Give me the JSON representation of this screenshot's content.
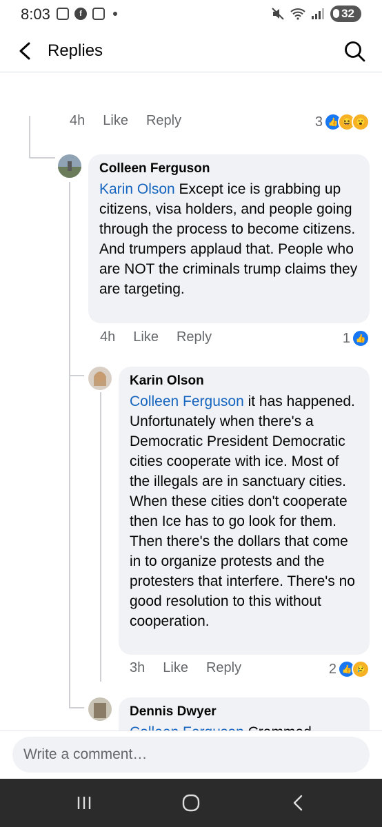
{
  "status_bar": {
    "time": "8:03",
    "battery": "32"
  },
  "header": {
    "title": "Replies"
  },
  "top_meta": {
    "time": "4h",
    "like": "Like",
    "reply": "Reply",
    "reaction_count": "3"
  },
  "comments": [
    {
      "author": "Colleen Ferguson",
      "mention": "Karin Olson",
      "text": " Except ice is grabbing up citizens, visa holders, and people going through the process to become citizens. And trumpers applaud that. People who are NOT the criminals trump claims they are targeting.",
      "time": "4h",
      "like": "Like",
      "reply": "Reply",
      "reaction_count": "1"
    },
    {
      "author": "Karin Olson",
      "mention": "Colleen Ferguson",
      "text": " it has happened.  Unfortunately when there's a Democratic President Democratic cities cooperate with ice.  Most of the illegals are in sanctuary cities.  When these cities don't cooperate then Ice has to go look for them.  Then there's the dollars that come in to organize protests and the protesters that interfere.  There's no good resolution to this without cooperation.",
      "time": "3h",
      "like": "Like",
      "reply": "Reply",
      "reaction_count": "2"
    },
    {
      "author": "Dennis Dwyer",
      "mention": "Colleen Ferguson",
      "text": " Crammed"
    }
  ],
  "composer": {
    "placeholder": "Write a comment…"
  },
  "colors": {
    "link": "#1565c0",
    "bubble": "#f0f2f5",
    "like_blue": "#1877f2",
    "navbar": "#2b2b2b"
  },
  "icons": [
    "back-arrow-icon",
    "search-icon",
    "like-reaction-icon",
    "haha-reaction-icon",
    "wow-reaction-icon",
    "sad-reaction-icon",
    "recent-apps-icon",
    "home-icon",
    "back-nav-icon"
  ]
}
